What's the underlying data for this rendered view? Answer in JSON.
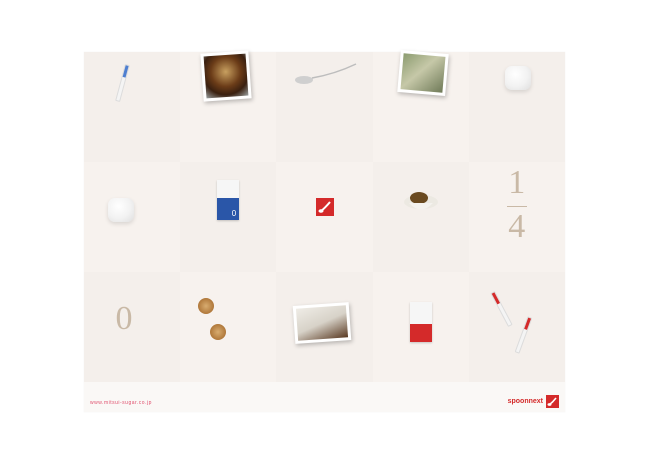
{
  "footer": {
    "url": "www.mitsui-sugar.co.jp",
    "brand": "spoonnext"
  },
  "tiles": {
    "fraction_numerator": "1",
    "fraction_denominator": "4",
    "zero": "0",
    "pack_label": "0"
  },
  "colors": {
    "accent_red": "#d42a2a",
    "url_pink": "#e0506e",
    "digit_beige": "#c9b9a6"
  }
}
